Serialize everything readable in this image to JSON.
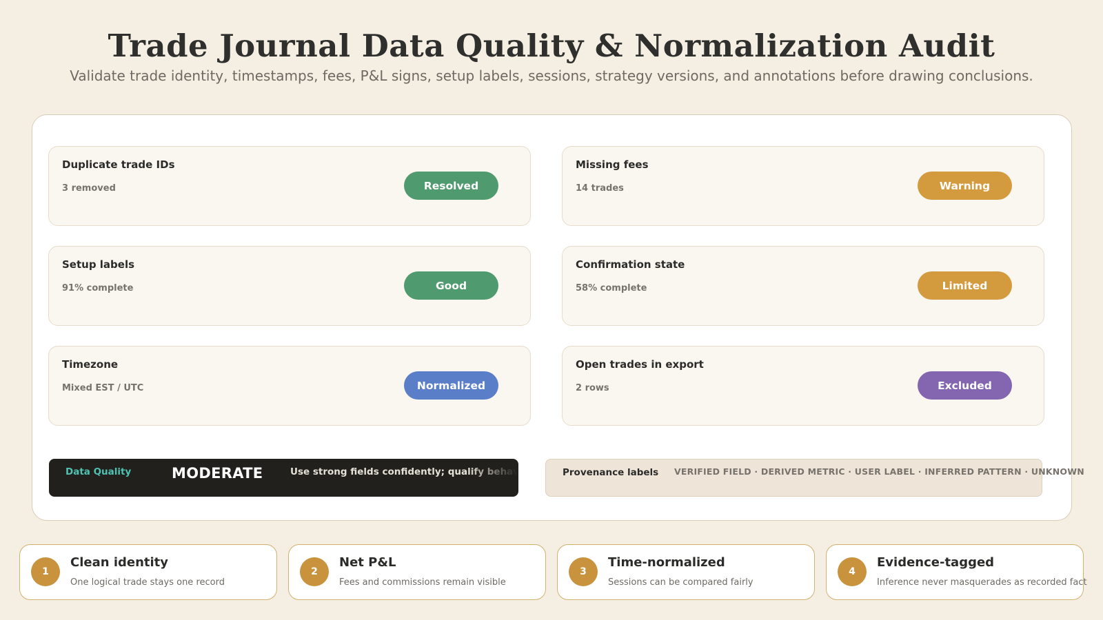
{
  "header": {
    "title": "Trade Journal Data Quality & Normalization Audit",
    "subtitle": "Validate trade identity, timestamps, fees, P&L signs, setup labels, sessions, strategy versions, and annotations before drawing conclusions."
  },
  "checks": [
    {
      "title": "Duplicate trade IDs",
      "detail": "3 removed",
      "status": "Resolved",
      "status_color": "#4f9a6e"
    },
    {
      "title": "Missing fees",
      "detail": "14 trades",
      "status": "Warning",
      "status_color": "#d49a3e"
    },
    {
      "title": "Setup labels",
      "detail": "91% complete",
      "status": "Good",
      "status_color": "#4f9a6e"
    },
    {
      "title": "Confirmation state",
      "detail": "58% complete",
      "status": "Limited",
      "status_color": "#d49a3e"
    },
    {
      "title": "Timezone",
      "detail": "Mixed EST / UTC",
      "status": "Normalized",
      "status_color": "#5a7fc8"
    },
    {
      "title": "Open trades in export",
      "detail": "2 rows",
      "status": "Excluded",
      "status_color": "#8466b0"
    }
  ],
  "quality": {
    "label": "Data Quality",
    "value": "MODERATE",
    "note": "Use strong fields confidently; qualify behavioral cl"
  },
  "provenance": {
    "title": "Provenance labels",
    "items": "VERIFIED FIELD · DERIVED METRIC · USER LABEL · INFERRED PATTERN · UNKNOWN"
  },
  "steps": [
    {
      "num": "1",
      "title": "Clean identity",
      "desc": "One logical trade stays one record"
    },
    {
      "num": "2",
      "title": "Net P&L",
      "desc": "Fees and commissions remain visible"
    },
    {
      "num": "3",
      "title": "Time-normalized",
      "desc": "Sessions can be compared fairly"
    },
    {
      "num": "4",
      "title": "Evidence-tagged",
      "desc": "Inference never masquerades as recorded fact"
    }
  ],
  "colors": {
    "background": "#f5eee2",
    "accent": "#c9933e",
    "quality_label": "#4ec3b2"
  }
}
